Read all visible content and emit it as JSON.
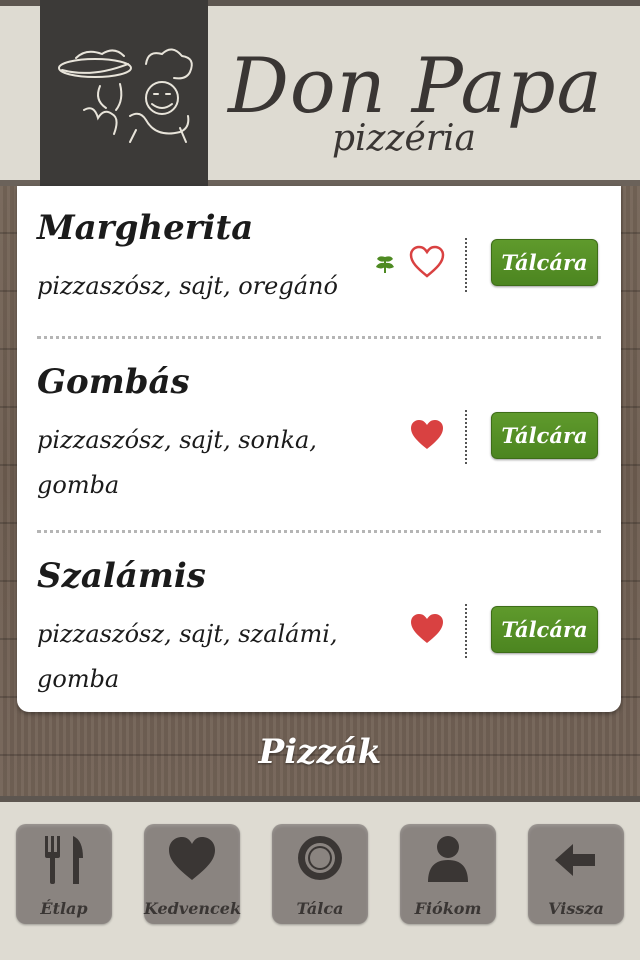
{
  "header": {
    "brand": "Don Papa",
    "subtitle": "pizzéria"
  },
  "menu": {
    "items": [
      {
        "name": "Margherita",
        "description": "pizzaszósz, sajt, oregánó",
        "vegetarian": true,
        "favorite": false,
        "button": "Tálcára"
      },
      {
        "name": "Gombás",
        "description": "pizzaszósz, sajt, sonka, gomba",
        "vegetarian": false,
        "favorite": true,
        "button": "Tálcára"
      },
      {
        "name": "Szalámis",
        "description": "pizzaszósz, sajt, szalámi, gomba",
        "vegetarian": false,
        "favorite": true,
        "button": "Tálcára"
      }
    ]
  },
  "section_title": "Pizzák",
  "nav": {
    "items": [
      {
        "label": "Étlap",
        "icon": "fork-knife-icon"
      },
      {
        "label": "Kedvencek",
        "icon": "heart-icon"
      },
      {
        "label": "Tálca",
        "icon": "plate-icon"
      },
      {
        "label": "Fiókom",
        "icon": "user-icon"
      },
      {
        "label": "Vissza",
        "icon": "back-arrow-icon"
      }
    ]
  },
  "colors": {
    "accent_green": "#5a9228",
    "heart_red": "#d94141",
    "leaf_green": "#4e8a22",
    "dark": "#3c3a38"
  }
}
